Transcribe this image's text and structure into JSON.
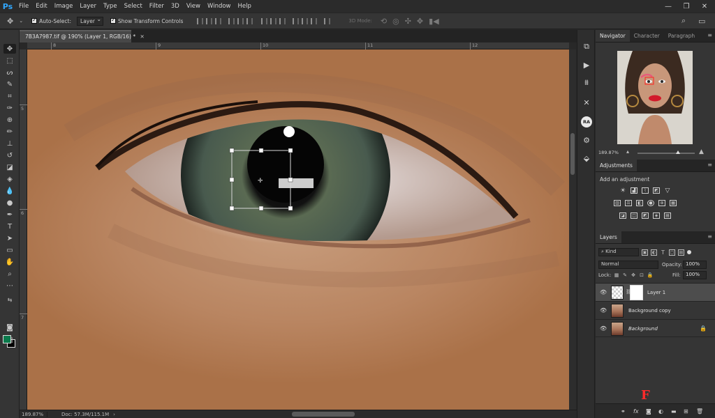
{
  "app": {
    "logo": "Ps",
    "menu": [
      "File",
      "Edit",
      "Image",
      "Layer",
      "Type",
      "Select",
      "Filter",
      "3D",
      "View",
      "Window",
      "Help"
    ]
  },
  "options_bar": {
    "auto_select_label": "Auto-Select:",
    "auto_select_value": "Layer",
    "show_transform_label": "Show Transform Controls",
    "mode_3d_label": "3D Mode:"
  },
  "document": {
    "tab_title": "7B3A7987.tif @ 190% (Layer 1, RGB/16) *",
    "zoom": "189.87%",
    "doc_size": "Doc: 57.3M/115.1M",
    "ruler_top": [
      "8",
      "9",
      "10",
      "11",
      "12"
    ],
    "ruler_left": [
      "5",
      "6",
      "7"
    ]
  },
  "colors": {
    "foreground": "#0b7a4c",
    "background": "#000000",
    "accent": "#31a8ff"
  },
  "icon_strip": {
    "ra_label": "RA"
  },
  "navigator": {
    "tabs": [
      "Navigator",
      "Character",
      "Paragraph"
    ],
    "zoom": "189.87%"
  },
  "adjustments": {
    "tab": "Adjustments",
    "title": "Add an adjustment"
  },
  "layers": {
    "tab": "Layers",
    "kind_label": "Kind",
    "blend_mode": "Normal",
    "opacity_label": "Opacity:",
    "opacity_value": "100%",
    "lock_label": "Lock:",
    "fill_label": "Fill:",
    "fill_value": "100%",
    "items": [
      {
        "name": "Layer 1"
      },
      {
        "name": "Background copy"
      },
      {
        "name": "Background"
      }
    ]
  },
  "overlay": {
    "marker": "F"
  }
}
